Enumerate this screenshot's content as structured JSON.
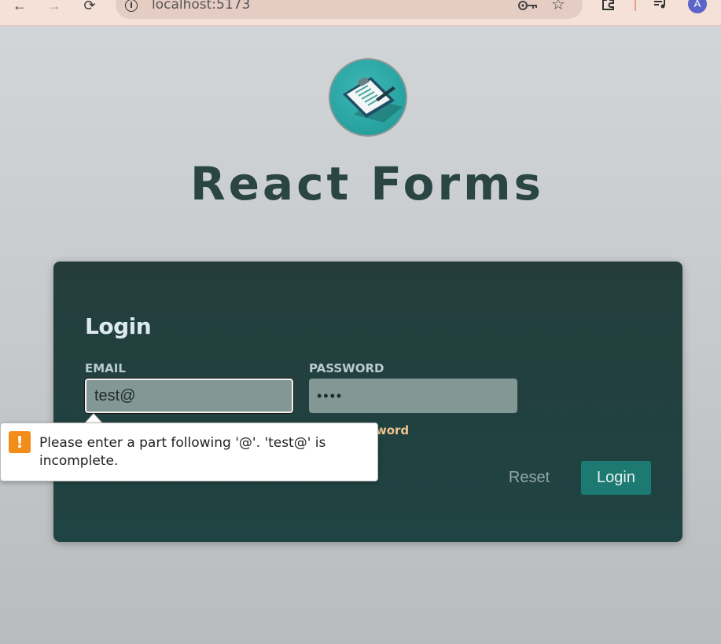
{
  "browser": {
    "url": "localhost:5173",
    "profile_initial": "A",
    "icons": {
      "back": "back-arrow-icon",
      "forward": "forward-arrow-icon",
      "reload": "reload-icon",
      "site_info": "info-icon",
      "password_key": "key-icon",
      "bookmark": "star-icon",
      "extensions": "puzzle-icon",
      "media": "queue-music-icon"
    }
  },
  "header": {
    "title": "React Forms",
    "logo_icon": "clipboard-icon"
  },
  "login": {
    "title": "Login",
    "email_label": "EMAIL",
    "email_value": "test@",
    "password_label": "PASSWORD",
    "password_value": "••••",
    "password_error": "valid password",
    "reset_label": "Reset",
    "login_label": "Login"
  },
  "validation_tooltip": {
    "icon": "warning-icon",
    "message": "Please enter a part following '@'. 'test@' is incomplete."
  },
  "colors": {
    "browser_bar": "#f6e1d9",
    "card_bg": "#243d3c",
    "title_text": "#2a4543",
    "login_button": "#1c7a72",
    "error_text": "#f0c48e",
    "warning_icon": "#f28c1a"
  }
}
